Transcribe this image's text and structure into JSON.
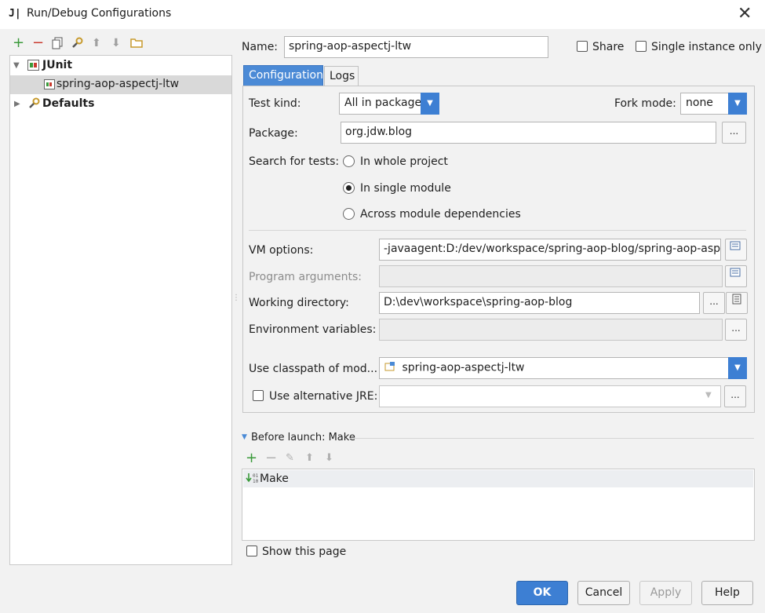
{
  "window": {
    "title": "Run/Debug Configurations",
    "icon": "intellij-app-icon"
  },
  "toolbar": {
    "icons": [
      "add-icon",
      "remove-icon",
      "copy-icon",
      "wrench-icon",
      "move-up-icon",
      "move-down-icon",
      "folder-icon"
    ]
  },
  "tree": {
    "junit_label": "JUnit",
    "junit_child": "spring-aop-aspectj-ltw",
    "defaults_label": "Defaults"
  },
  "header": {
    "name_label": "Name:",
    "name_value": "spring-aop-aspectj-ltw",
    "share_label": "Share",
    "single_instance_label": "Single instance only"
  },
  "tabs": {
    "configuration": "Configuration",
    "logs": "Logs"
  },
  "config": {
    "test_kind_label": "Test kind:",
    "test_kind_value": "All in package",
    "fork_mode_label": "Fork mode:",
    "fork_mode_value": "none",
    "package_label": "Package:",
    "package_value": "org.jdw.blog",
    "search_label": "Search for tests:",
    "radio_whole": "In whole project",
    "radio_single": "In single module",
    "radio_across": "Across module dependencies",
    "vm_label": "VM options:",
    "vm_value": "-javaagent:D:/dev/workspace/spring-aop-blog/spring-aop-aspe",
    "program_label": "Program arguments:",
    "program_value": "",
    "workdir_label": "Working directory:",
    "workdir_value": "D:\\dev\\workspace\\spring-aop-blog",
    "env_label": "Environment variables:",
    "env_value": "",
    "classpath_label": "Use classpath of mod...",
    "classpath_value": "spring-aop-aspectj-ltw",
    "alt_jre_label": "Use alternative JRE:",
    "alt_jre_value": "",
    "ellipsis": "..."
  },
  "before_launch": {
    "title": "Before launch: Make",
    "item": "Make"
  },
  "show_page_label": "Show this page",
  "buttons": {
    "ok": "OK",
    "cancel": "Cancel",
    "apply": "Apply",
    "help": "Help"
  }
}
